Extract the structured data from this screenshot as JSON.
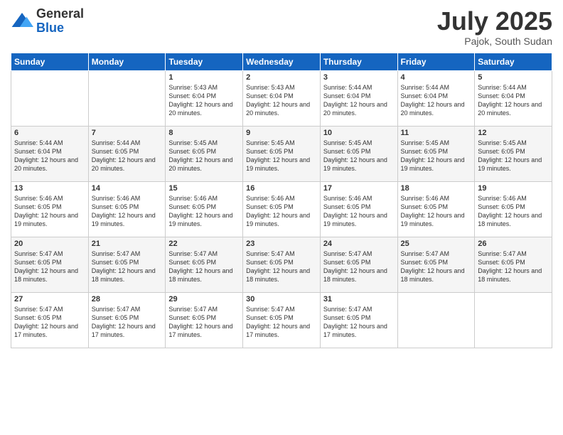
{
  "logo": {
    "general": "General",
    "blue": "Blue"
  },
  "header": {
    "month": "July 2025",
    "location": "Pajok, South Sudan"
  },
  "days": [
    "Sunday",
    "Monday",
    "Tuesday",
    "Wednesday",
    "Thursday",
    "Friday",
    "Saturday"
  ],
  "weeks": [
    [
      {
        "day": null,
        "info": null
      },
      {
        "day": null,
        "info": null
      },
      {
        "day": "1",
        "info": "Sunrise: 5:43 AM\nSunset: 6:04 PM\nDaylight: 12 hours and 20 minutes."
      },
      {
        "day": "2",
        "info": "Sunrise: 5:43 AM\nSunset: 6:04 PM\nDaylight: 12 hours and 20 minutes."
      },
      {
        "day": "3",
        "info": "Sunrise: 5:44 AM\nSunset: 6:04 PM\nDaylight: 12 hours and 20 minutes."
      },
      {
        "day": "4",
        "info": "Sunrise: 5:44 AM\nSunset: 6:04 PM\nDaylight: 12 hours and 20 minutes."
      },
      {
        "day": "5",
        "info": "Sunrise: 5:44 AM\nSunset: 6:04 PM\nDaylight: 12 hours and 20 minutes."
      }
    ],
    [
      {
        "day": "6",
        "info": "Sunrise: 5:44 AM\nSunset: 6:04 PM\nDaylight: 12 hours and 20 minutes."
      },
      {
        "day": "7",
        "info": "Sunrise: 5:44 AM\nSunset: 6:05 PM\nDaylight: 12 hours and 20 minutes."
      },
      {
        "day": "8",
        "info": "Sunrise: 5:45 AM\nSunset: 6:05 PM\nDaylight: 12 hours and 20 minutes."
      },
      {
        "day": "9",
        "info": "Sunrise: 5:45 AM\nSunset: 6:05 PM\nDaylight: 12 hours and 19 minutes."
      },
      {
        "day": "10",
        "info": "Sunrise: 5:45 AM\nSunset: 6:05 PM\nDaylight: 12 hours and 19 minutes."
      },
      {
        "day": "11",
        "info": "Sunrise: 5:45 AM\nSunset: 6:05 PM\nDaylight: 12 hours and 19 minutes."
      },
      {
        "day": "12",
        "info": "Sunrise: 5:45 AM\nSunset: 6:05 PM\nDaylight: 12 hours and 19 minutes."
      }
    ],
    [
      {
        "day": "13",
        "info": "Sunrise: 5:46 AM\nSunset: 6:05 PM\nDaylight: 12 hours and 19 minutes."
      },
      {
        "day": "14",
        "info": "Sunrise: 5:46 AM\nSunset: 6:05 PM\nDaylight: 12 hours and 19 minutes."
      },
      {
        "day": "15",
        "info": "Sunrise: 5:46 AM\nSunset: 6:05 PM\nDaylight: 12 hours and 19 minutes."
      },
      {
        "day": "16",
        "info": "Sunrise: 5:46 AM\nSunset: 6:05 PM\nDaylight: 12 hours and 19 minutes."
      },
      {
        "day": "17",
        "info": "Sunrise: 5:46 AM\nSunset: 6:05 PM\nDaylight: 12 hours and 19 minutes."
      },
      {
        "day": "18",
        "info": "Sunrise: 5:46 AM\nSunset: 6:05 PM\nDaylight: 12 hours and 19 minutes."
      },
      {
        "day": "19",
        "info": "Sunrise: 5:46 AM\nSunset: 6:05 PM\nDaylight: 12 hours and 18 minutes."
      }
    ],
    [
      {
        "day": "20",
        "info": "Sunrise: 5:47 AM\nSunset: 6:05 PM\nDaylight: 12 hours and 18 minutes."
      },
      {
        "day": "21",
        "info": "Sunrise: 5:47 AM\nSunset: 6:05 PM\nDaylight: 12 hours and 18 minutes."
      },
      {
        "day": "22",
        "info": "Sunrise: 5:47 AM\nSunset: 6:05 PM\nDaylight: 12 hours and 18 minutes."
      },
      {
        "day": "23",
        "info": "Sunrise: 5:47 AM\nSunset: 6:05 PM\nDaylight: 12 hours and 18 minutes."
      },
      {
        "day": "24",
        "info": "Sunrise: 5:47 AM\nSunset: 6:05 PM\nDaylight: 12 hours and 18 minutes."
      },
      {
        "day": "25",
        "info": "Sunrise: 5:47 AM\nSunset: 6:05 PM\nDaylight: 12 hours and 18 minutes."
      },
      {
        "day": "26",
        "info": "Sunrise: 5:47 AM\nSunset: 6:05 PM\nDaylight: 12 hours and 18 minutes."
      }
    ],
    [
      {
        "day": "27",
        "info": "Sunrise: 5:47 AM\nSunset: 6:05 PM\nDaylight: 12 hours and 17 minutes."
      },
      {
        "day": "28",
        "info": "Sunrise: 5:47 AM\nSunset: 6:05 PM\nDaylight: 12 hours and 17 minutes."
      },
      {
        "day": "29",
        "info": "Sunrise: 5:47 AM\nSunset: 6:05 PM\nDaylight: 12 hours and 17 minutes."
      },
      {
        "day": "30",
        "info": "Sunrise: 5:47 AM\nSunset: 6:05 PM\nDaylight: 12 hours and 17 minutes."
      },
      {
        "day": "31",
        "info": "Sunrise: 5:47 AM\nSunset: 6:05 PM\nDaylight: 12 hours and 17 minutes."
      },
      {
        "day": null,
        "info": null
      },
      {
        "day": null,
        "info": null
      }
    ]
  ]
}
